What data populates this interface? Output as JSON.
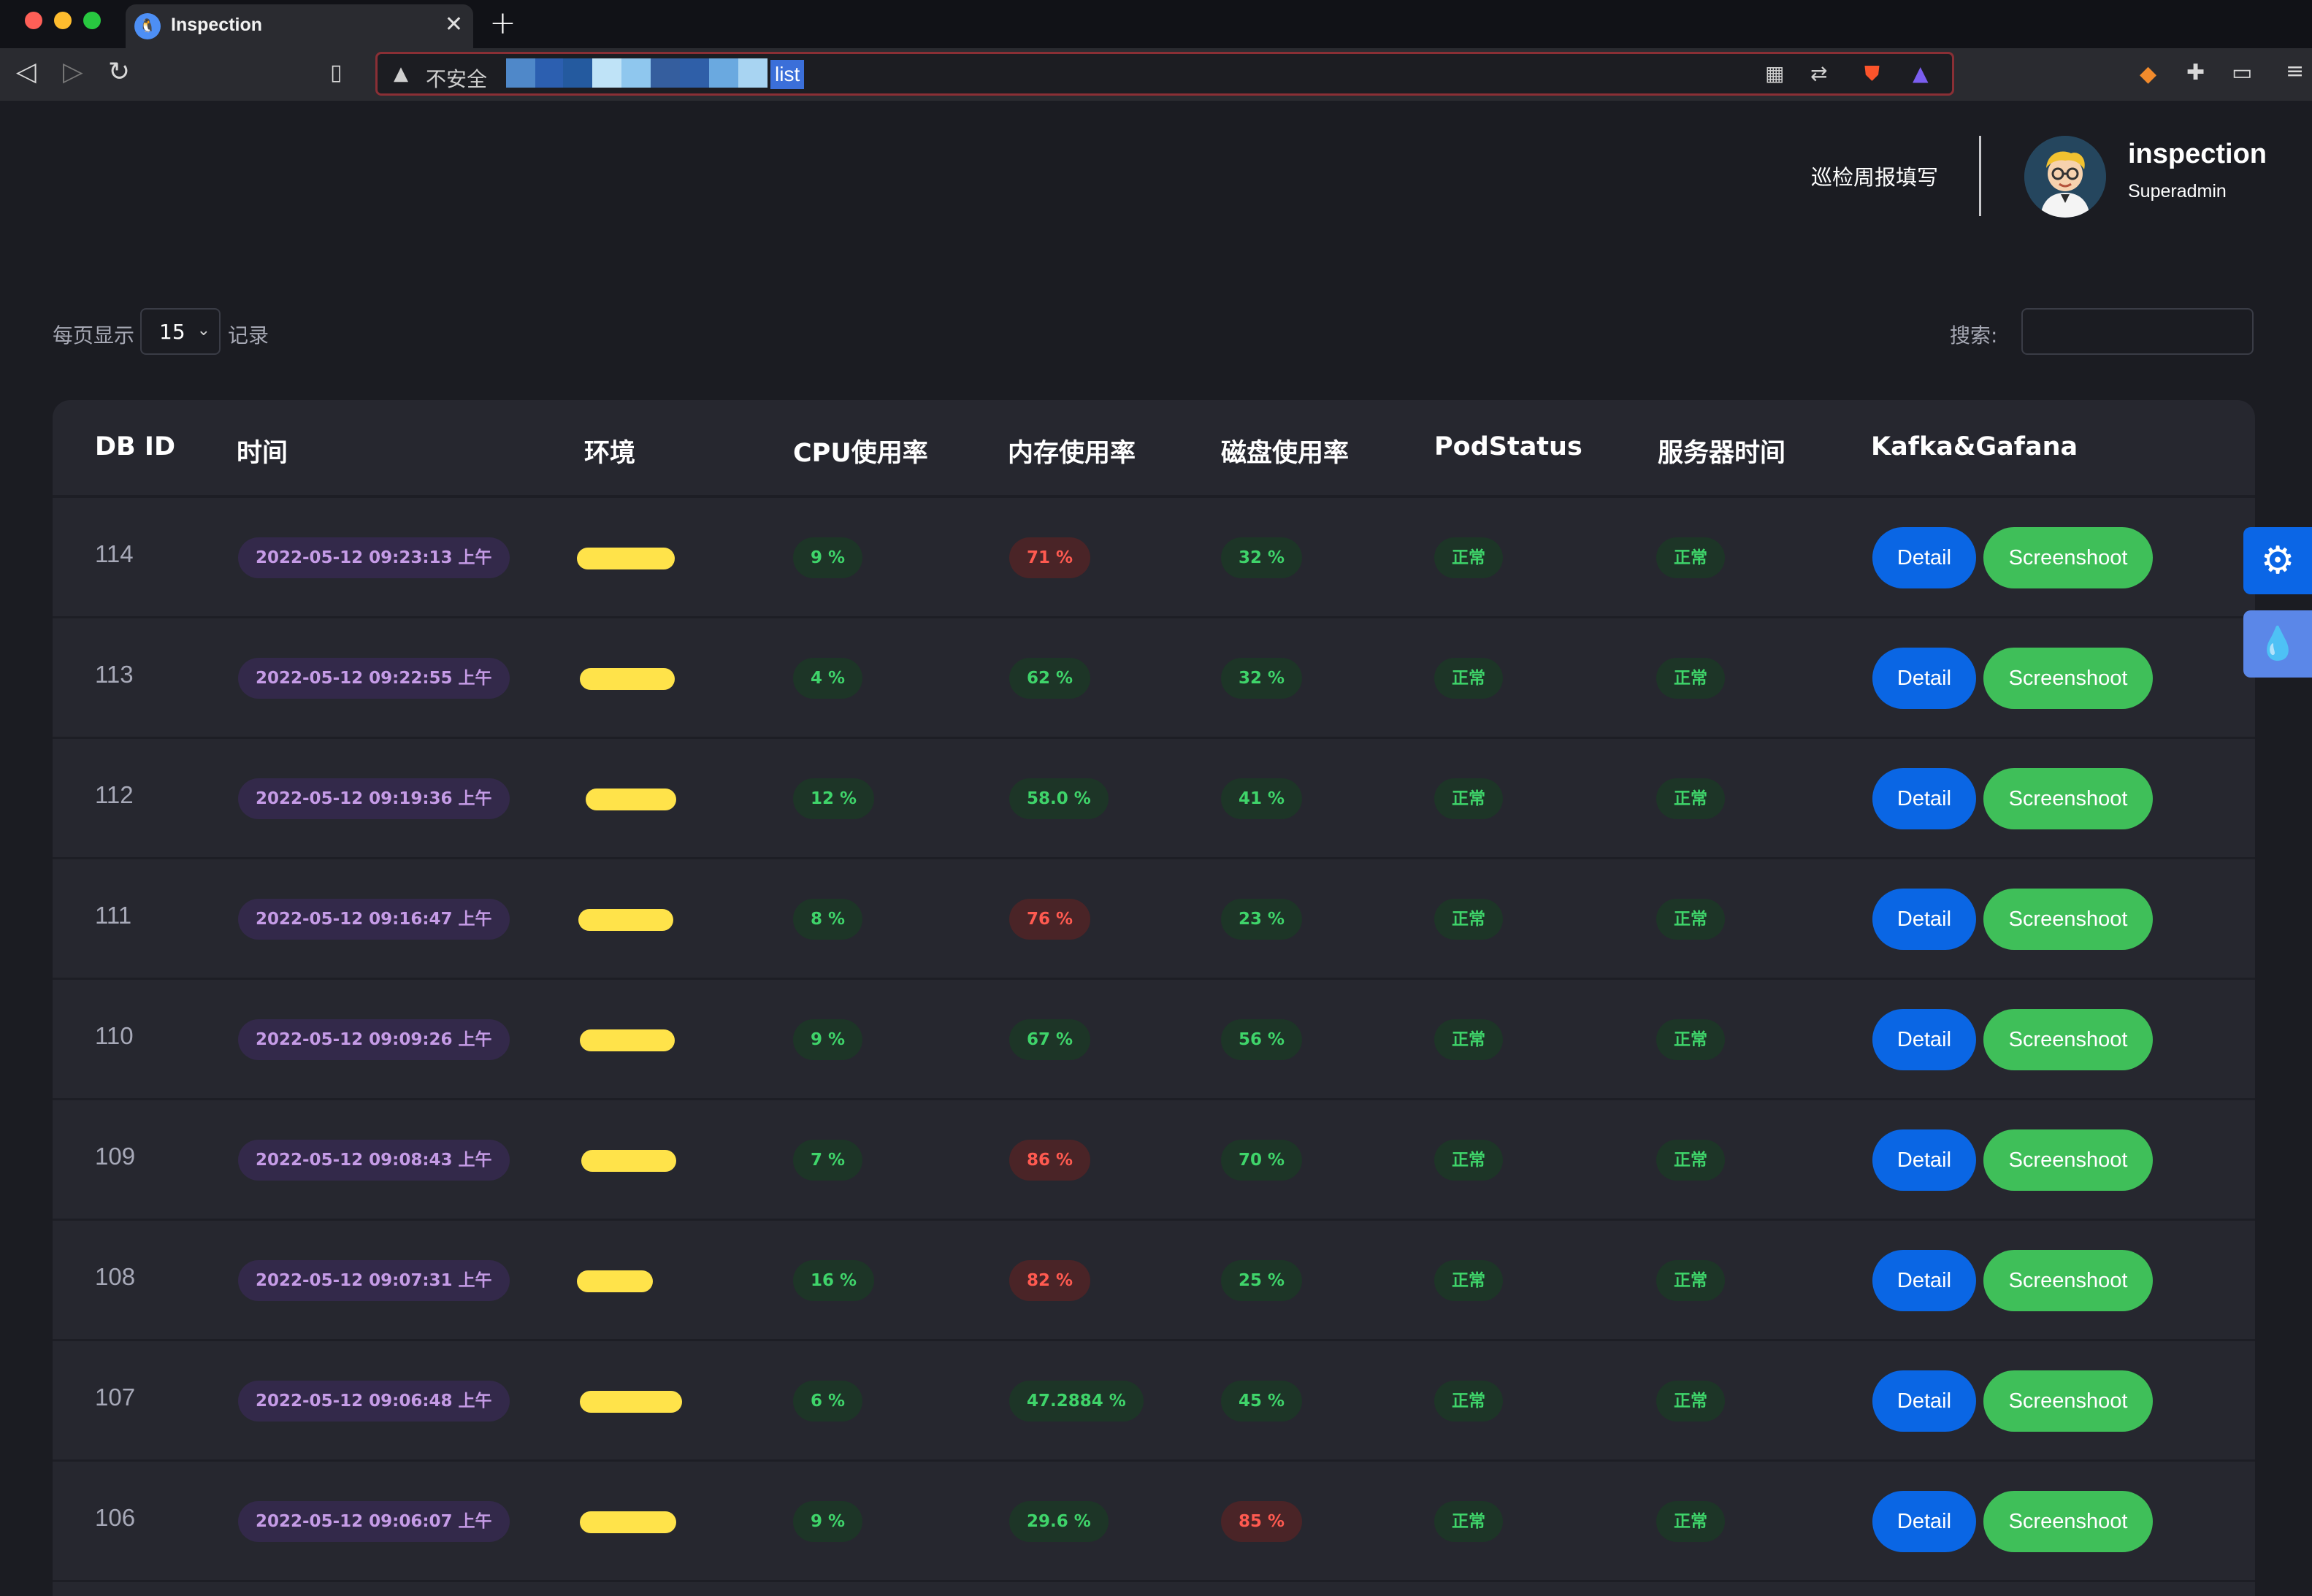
{
  "browser": {
    "tab_title": "Inspection",
    "url_security": "不安全",
    "url_visible": "list"
  },
  "header": {
    "link_label": "巡检周报填写",
    "user_name": "inspection",
    "user_role": "Superadmin"
  },
  "controls": {
    "length_prefix": "每页显示",
    "length_value": "15",
    "length_suffix": "记录",
    "search_label": "搜索:"
  },
  "table": {
    "columns": [
      "DB ID",
      "时间",
      "环境",
      "CPU使用率",
      "内存使用率",
      "磁盘使用率",
      "PodStatus",
      "服务器时间",
      "Kafka&Gafana"
    ],
    "detail_label": "Detail",
    "screenshot_label": "Screenshoot",
    "rows": [
      {
        "id": "114",
        "time": "2022-05-12 09:23:13 上午",
        "cpu": "9 %",
        "cpu_status": "green",
        "mem": "71 %",
        "mem_status": "red",
        "disk": "32 %",
        "disk_status": "green",
        "pod": "正常",
        "srv": "正常"
      },
      {
        "id": "113",
        "time": "2022-05-12 09:22:55 上午",
        "cpu": "4 %",
        "cpu_status": "green",
        "mem": "62 %",
        "mem_status": "green",
        "disk": "32 %",
        "disk_status": "green",
        "pod": "正常",
        "srv": "正常"
      },
      {
        "id": "112",
        "time": "2022-05-12 09:19:36 上午",
        "cpu": "12 %",
        "cpu_status": "green",
        "mem": "58.0 %",
        "mem_status": "green",
        "disk": "41 %",
        "disk_status": "green",
        "pod": "正常",
        "srv": "正常"
      },
      {
        "id": "111",
        "time": "2022-05-12 09:16:47 上午",
        "cpu": "8 %",
        "cpu_status": "green",
        "mem": "76 %",
        "mem_status": "red",
        "disk": "23 %",
        "disk_status": "green",
        "pod": "正常",
        "srv": "正常"
      },
      {
        "id": "110",
        "time": "2022-05-12 09:09:26 上午",
        "cpu": "9 %",
        "cpu_status": "green",
        "mem": "67 %",
        "mem_status": "green",
        "disk": "56 %",
        "disk_status": "green",
        "pod": "正常",
        "srv": "正常"
      },
      {
        "id": "109",
        "time": "2022-05-12 09:08:43 上午",
        "cpu": "7 %",
        "cpu_status": "green",
        "mem": "86 %",
        "mem_status": "red",
        "disk": "70 %",
        "disk_status": "green",
        "pod": "正常",
        "srv": "正常"
      },
      {
        "id": "108",
        "time": "2022-05-12 09:07:31 上午",
        "cpu": "16 %",
        "cpu_status": "green",
        "mem": "82 %",
        "mem_status": "red",
        "disk": "25 %",
        "disk_status": "green",
        "pod": "正常",
        "srv": "正常"
      },
      {
        "id": "107",
        "time": "2022-05-12 09:06:48 上午",
        "cpu": "6 %",
        "cpu_status": "green",
        "mem": "47.2884 %",
        "mem_status": "green",
        "disk": "45 %",
        "disk_status": "green",
        "pod": "正常",
        "srv": "正常"
      },
      {
        "id": "106",
        "time": "2022-05-12 09:06:07 上午",
        "cpu": "9 %",
        "cpu_status": "green",
        "mem": "29.6 %",
        "mem_status": "green",
        "disk": "85 %",
        "disk_status": "red",
        "pod": "正常",
        "srv": "正常"
      }
    ]
  },
  "colors": {
    "background": "#1b1c22",
    "card": "#26272f",
    "detail_button": "#0a66e4",
    "screenshot_button": "#3fbf59",
    "ok_text": "#3fd46a",
    "warn_text": "#ff5a50",
    "time_text": "#c59be6",
    "env_redaction": "#ffe34a"
  },
  "icons": {
    "float_top": "gear-icon",
    "float_bottom": "droplet-icon"
  }
}
